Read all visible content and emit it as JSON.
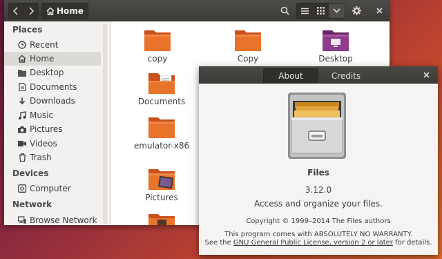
{
  "files_window": {
    "header": {
      "back_icon": "chevron-left-icon",
      "forward_icon": "chevron-right-icon",
      "path_label": "Home",
      "path_icon": "home-icon",
      "search_icon": "search-icon",
      "list_view_icon": "list-icon",
      "grid_view_icon": "grid-icon",
      "view_menu_icon": "chevron-down-icon",
      "settings_icon": "gear-icon",
      "close_icon": "close-icon"
    },
    "sidebar": {
      "places_heading": "Places",
      "places": [
        {
          "label": "Recent",
          "icon": "clock-icon"
        },
        {
          "label": "Home",
          "icon": "home-icon",
          "selected": true
        },
        {
          "label": "Desktop",
          "icon": "folder-icon"
        },
        {
          "label": "Documents",
          "icon": "document-icon"
        },
        {
          "label": "Downloads",
          "icon": "download-icon"
        },
        {
          "label": "Music",
          "icon": "music-icon"
        },
        {
          "label": "Pictures",
          "icon": "camera-icon"
        },
        {
          "label": "Videos",
          "icon": "video-icon"
        },
        {
          "label": "Trash",
          "icon": "trash-icon"
        }
      ],
      "devices_heading": "Devices",
      "devices": [
        {
          "label": "Computer",
          "icon": "drive-icon"
        }
      ],
      "network_heading": "Network",
      "network": [
        {
          "label": "Browse Network",
          "icon": "network-icon"
        }
      ]
    },
    "files": [
      {
        "name": "copy",
        "icon": "folder-icon"
      },
      {
        "name": "Copy",
        "icon": "folder-icon"
      },
      {
        "name": "Desktop",
        "icon": "desktop-folder-icon"
      },
      {
        "name": "Documents",
        "icon": "documents-folder-icon"
      },
      {
        "name": "emulator-x86",
        "icon": "folder-icon"
      },
      {
        "name": "Pictures",
        "icon": "pictures-folder-icon"
      },
      {
        "name": "",
        "icon": "videos-folder-icon"
      }
    ]
  },
  "about_dialog": {
    "tabs": [
      {
        "label": "About",
        "active": true
      },
      {
        "label": "Credits",
        "active": false
      }
    ],
    "close_icon": "close-icon",
    "app_icon": "file-cabinet-icon",
    "app_name": "Files",
    "version": "3.12.0",
    "description": "Access and organize your files.",
    "copyright": "Copyright © 1999–2014 The Files authors",
    "warranty_line1": "This program comes with ABSOLUTELY NO WARRANTY.",
    "warranty_line2_prefix": "See the ",
    "license_link": "GNU General Public License, version 2 or later",
    "warranty_line2_suffix": " for details."
  }
}
